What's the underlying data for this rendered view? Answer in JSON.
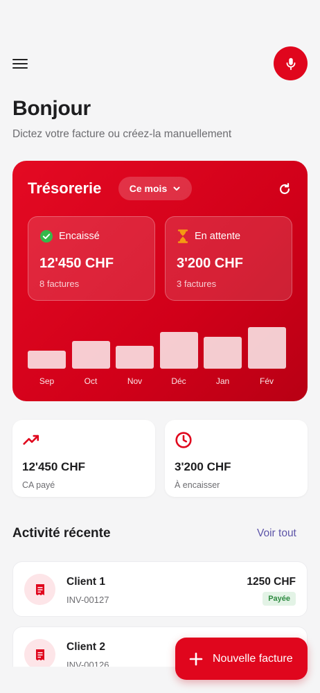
{
  "header": {
    "menu_icon": "menu-icon",
    "mic_icon": "microphone-icon"
  },
  "greeting": {
    "title": "Bonjour",
    "subtitle": "Dictez votre facture ou créez-la manuellement"
  },
  "treasury": {
    "title": "Trésorerie",
    "period_label": "Ce mois",
    "cashed": {
      "label": "Encaissé",
      "amount": "12'450 CHF",
      "count": "8 factures"
    },
    "pending": {
      "label": "En attente",
      "amount": "3'200 CHF",
      "count": "3 factures"
    }
  },
  "chart_data": {
    "type": "bar",
    "categories": [
      "Sep",
      "Oct",
      "Nov",
      "Déc",
      "Jan",
      "Fév"
    ],
    "values": [
      0.43,
      0.67,
      0.55,
      0.88,
      0.77,
      1.0
    ]
  },
  "kpis": [
    {
      "amount": "12'450 CHF",
      "label": "CA payé",
      "icon": "trending-up-icon"
    },
    {
      "amount": "3'200 CHF",
      "label": "À encaisser",
      "icon": "clock-icon"
    }
  ],
  "recent": {
    "title": "Activité récente",
    "see_all": "Voir tout",
    "items": [
      {
        "client": "Client 1",
        "invoice": "INV-00127",
        "amount": "1250 CHF",
        "status": "Payée"
      },
      {
        "client": "Client 2",
        "invoice": "INV-00126"
      }
    ]
  },
  "fab": {
    "label": "Nouvelle facture"
  },
  "colors": {
    "accent": "#e0061d",
    "link": "#5d55a8",
    "paid": "#2e8b41"
  }
}
